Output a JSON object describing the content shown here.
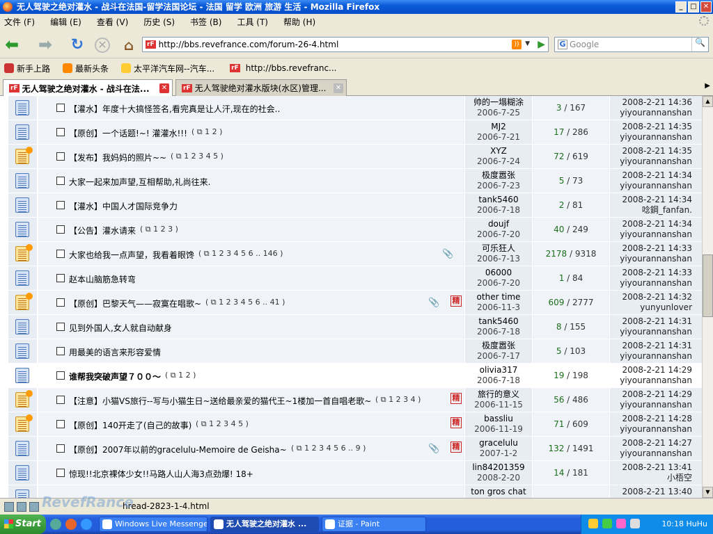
{
  "window": {
    "title": "无人驾驶之绝对灌水 - 战斗在法国-留学法国论坛 - 法国 留学 欧洲 旅游 生活 - Mozilla Firefox"
  },
  "menu": [
    "文件 (F)",
    "编辑 (E)",
    "查看 (V)",
    "历史 (S)",
    "书签 (B)",
    "工具 (T)",
    "帮助 (H)"
  ],
  "address": {
    "logo": "rF",
    "url": "http://bbs.revefrance.com/forum-26-4.html"
  },
  "search": {
    "placeholder": "Google",
    "engine": "G"
  },
  "bookmarks": [
    "新手上路",
    "最新头条",
    "太平洋汽车网--汽车...",
    "http://bbs.revefranc..."
  ],
  "tabs": [
    {
      "label": "无人驾驶之绝对灌水 - 战斗在法...",
      "active": true
    },
    {
      "label": "无人驾驶绝对灌水版块(水区)管理...",
      "active": false
    }
  ],
  "threads": [
    {
      "title": "【灌水】年度十大搞怪签名,看完真是让人汗,现在的社会..",
      "hot": false,
      "pages": "",
      "clip": false,
      "digest": false,
      "author": "帅的一塌糊涂",
      "date": "2006-7-25",
      "replies": "3",
      "views": "167",
      "last_time": "2008-2-21 14:36",
      "last_user": "yiyourannanshan"
    },
    {
      "title": "【原创】一个话题!~! 灌灌水!!!",
      "hot": false,
      "pages": "( ⧉ 1  2 )",
      "clip": false,
      "digest": false,
      "author": "MJ2",
      "date": "2006-7-21",
      "replies": "17",
      "views": "286",
      "last_time": "2008-2-21 14:35",
      "last_user": "yiyourannanshan"
    },
    {
      "title": "【发布】我妈妈的照片~~",
      "hot": true,
      "pages": "( ⧉ 1  2  3  4  5 )",
      "clip": false,
      "digest": false,
      "author": "XYZ",
      "date": "2006-7-24",
      "replies": "72",
      "views": "619",
      "last_time": "2008-2-21 14:35",
      "last_user": "yiyourannanshan"
    },
    {
      "title": "大家一起来加声望,互相帮助,礼尚往来.",
      "hot": false,
      "pages": "",
      "clip": false,
      "digest": false,
      "author": "极度嚣张",
      "date": "2006-7-23",
      "replies": "5",
      "views": "73",
      "last_time": "2008-2-21 14:34",
      "last_user": "yiyourannanshan"
    },
    {
      "title": "【灌水】中国人才国际竞争力",
      "hot": false,
      "pages": "",
      "clip": false,
      "digest": false,
      "author": "tank5460",
      "date": "2006-7-18",
      "replies": "2",
      "views": "81",
      "last_time": "2008-2-21 14:34",
      "last_user": "唸鋼_fanfan."
    },
    {
      "title": "【公告】灌水请来",
      "hot": false,
      "pages": "( ⧉ 1  2  3 )",
      "clip": false,
      "digest": false,
      "author": "doujf",
      "date": "2006-7-20",
      "replies": "40",
      "views": "249",
      "last_time": "2008-2-21 14:34",
      "last_user": "yiyourannanshan"
    },
    {
      "title": "大家也给我一点声望，我看着眼馋",
      "hot": true,
      "pages": "( ⧉ 1  2  3  4  5  6 ..  146 )",
      "clip": true,
      "digest": false,
      "author": "可乐狂人",
      "date": "2006-7-13",
      "replies": "2178",
      "views": "9318",
      "last_time": "2008-2-21 14:33",
      "last_user": "yiyourannanshan"
    },
    {
      "title": "赵本山脑筋急转弯",
      "hot": false,
      "pages": "",
      "clip": false,
      "digest": false,
      "author": "06000",
      "date": "2006-7-20",
      "replies": "1",
      "views": "84",
      "last_time": "2008-2-21 14:33",
      "last_user": "yiyourannanshan"
    },
    {
      "title": "【原创】巴黎天气——寂寞在唱歌~",
      "hot": true,
      "pages": "( ⧉ 1  2  3  4  5  6 ..  41 )",
      "clip": true,
      "digest": true,
      "author": "other time",
      "date": "2006-11-3",
      "replies": "609",
      "views": "2777",
      "last_time": "2008-2-21 14:32",
      "last_user": "yunyunlover"
    },
    {
      "title": "见到外国人,女人就自动献身",
      "hot": false,
      "pages": "",
      "clip": false,
      "digest": false,
      "author": "tank5460",
      "date": "2006-7-18",
      "replies": "8",
      "views": "155",
      "last_time": "2008-2-21 14:31",
      "last_user": "yiyourannanshan"
    },
    {
      "title": "用最美的语言来形容爱情",
      "hot": false,
      "pages": "",
      "clip": false,
      "digest": false,
      "author": "极度嚣张",
      "date": "2006-7-17",
      "replies": "5",
      "views": "103",
      "last_time": "2008-2-21 14:31",
      "last_user": "yiyourannanshan"
    },
    {
      "title": "谁帮我突破声望７００～",
      "hot": false,
      "pages": "( ⧉ 1  2 )",
      "clip": false,
      "digest": false,
      "author": "olivia317",
      "date": "2006-7-18",
      "replies": "19",
      "views": "198",
      "last_time": "2008-2-21 14:29",
      "last_user": "yiyourannanshan"
    },
    {
      "title": "【注意】小猫VS旅行--写与小猫生日~送给最亲爱的猫代王~1楼加一首自唱老歌~",
      "hot": true,
      "pages": "( ⧉ 1  2  3  4 )",
      "clip": false,
      "digest": true,
      "author": "旅行的意义",
      "date": "2006-11-15",
      "replies": "56",
      "views": "486",
      "last_time": "2008-2-21 14:29",
      "last_user": "yiyourannanshan"
    },
    {
      "title": "【原创】140开走了(自己的故事)",
      "hot": true,
      "pages": "( ⧉ 1  2  3  4  5 )",
      "clip": false,
      "digest": true,
      "author": "bassliu",
      "date": "2006-11-19",
      "replies": "71",
      "views": "609",
      "last_time": "2008-2-21 14:28",
      "last_user": "yiyourannanshan"
    },
    {
      "title": "【原创】2007年以前的gracelulu-Memoire de Geisha~",
      "hot": false,
      "pages": "( ⧉ 1  2  3  4  5  6 ..  9 )",
      "clip": true,
      "digest": true,
      "author": "gracelulu",
      "date": "2007-1-2",
      "replies": "132",
      "views": "1491",
      "last_time": "2008-2-21 14:27",
      "last_user": "yiyourannanshan"
    },
    {
      "title": "惊现!!北京裸体少女!!马路人山人海3点劲爆! 18+",
      "hot": false,
      "pages": "",
      "clip": false,
      "digest": false,
      "author": "lin84201359",
      "date": "2008-2-20",
      "replies": "14",
      "views": "181",
      "last_time": "2008-2-21 13:41",
      "last_user": "小梧空"
    },
    {
      "title": "",
      "hot": false,
      "pages": "",
      "clip": false,
      "digest": false,
      "author": "ton gros chat",
      "date": "",
      "replies": "",
      "views": "",
      "last_time": "2008-2-21 13:40",
      "last_user": ""
    }
  ],
  "digest_mark": "精",
  "status": {
    "text": "hread-2823-1-4.html",
    "watermark": "RevefRance"
  },
  "taskbar": {
    "start": "Start",
    "tasks": [
      {
        "label": "Windows Live Messenger",
        "active": false
      },
      {
        "label": "无人驾驶之绝对灌水 ...",
        "active": true
      },
      {
        "label": "证据 - Paint",
        "active": false
      }
    ],
    "clock": "10:18 HuHu"
  }
}
